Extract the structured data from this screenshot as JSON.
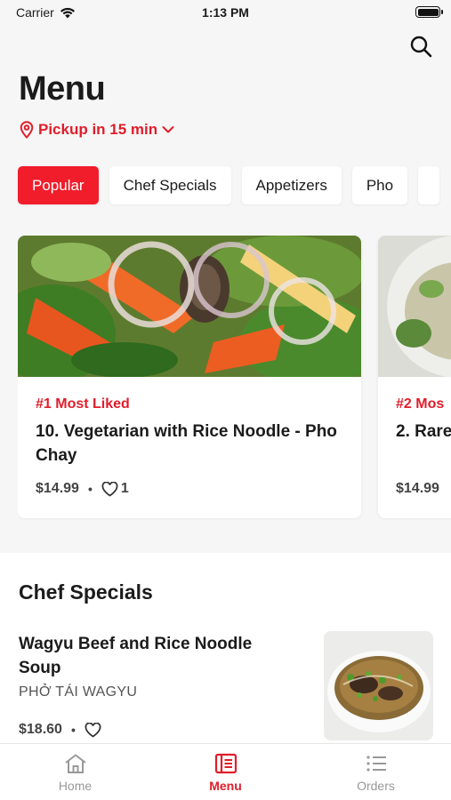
{
  "status_bar": {
    "carrier": "Carrier",
    "time": "1:13 PM"
  },
  "header": {
    "title": "Menu",
    "search_icon": "search-icon"
  },
  "pickup": {
    "label": "Pickup in 15 min",
    "icon": "location-pin-icon"
  },
  "categories": [
    {
      "label": "Popular",
      "active": true
    },
    {
      "label": "Chef Specials",
      "active": false
    },
    {
      "label": "Appetizers",
      "active": false
    },
    {
      "label": "Pho",
      "active": false
    }
  ],
  "featured": [
    {
      "badge": "#1 Most Liked",
      "name": "10. Vegetarian with Rice Noodle - Pho Chay",
      "price": "$14.99",
      "likes": "1"
    },
    {
      "badge": "#2 Mos",
      "name": "2. Rare",
      "price": "$14.99",
      "likes": ""
    }
  ],
  "chef_specials": {
    "title": "Chef Specials",
    "items": [
      {
        "name": "Wagyu Beef and Rice Noodle Soup",
        "subtitle": "PHỞ TÁI WAGYU",
        "price": "$18.60"
      }
    ]
  },
  "tabbar": [
    {
      "label": "Home",
      "icon": "home-icon",
      "active": false
    },
    {
      "label": "Menu",
      "icon": "menu-book-icon",
      "active": true
    },
    {
      "label": "Orders",
      "icon": "list-icon",
      "active": false
    }
  ],
  "colors": {
    "accent": "#f11d2b",
    "background": "#f6f6f6"
  }
}
